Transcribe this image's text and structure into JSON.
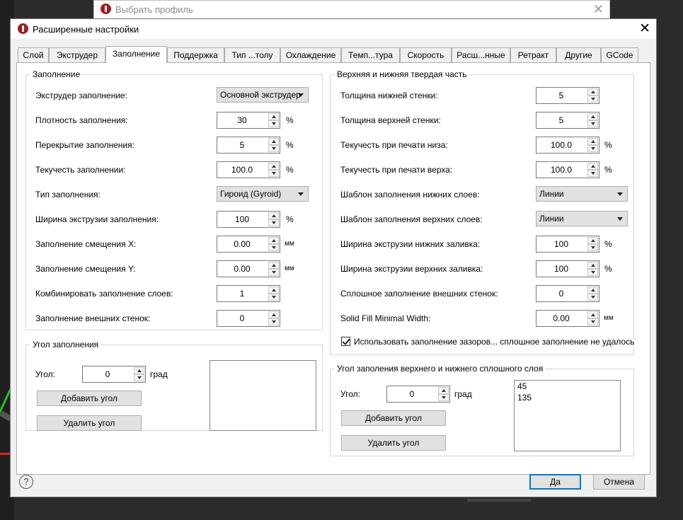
{
  "back_window": {
    "title": "Выбрать профиль",
    "close_glyph": "✕"
  },
  "dialog": {
    "title": "Расширенные настройки",
    "close_glyph": "✕"
  },
  "tabs": [
    {
      "label": "Слой"
    },
    {
      "label": "Экструдер"
    },
    {
      "label": "Заполнение"
    },
    {
      "label": "Поддержка"
    },
    {
      "label": "Тип ...толу"
    },
    {
      "label": "Охлаждение"
    },
    {
      "label": "Темп...тура"
    },
    {
      "label": "Скорость"
    },
    {
      "label": "Расш...нные"
    },
    {
      "label": "Ретракт"
    },
    {
      "label": "Другие"
    },
    {
      "label": "GCode"
    }
  ],
  "active_tab": "Заполнение",
  "infill": {
    "title": "Заполнение",
    "extruder_label": "Экструдер заполнение:",
    "extruder_value": "Основной экструдер",
    "density_label": "Плотность заполнения:",
    "density_value": "30",
    "density_unit": "%",
    "overlap_label": "Перекрытие заполнения:",
    "overlap_value": "5",
    "overlap_unit": "%",
    "flow_label": "Текучесть заполнении:",
    "flow_value": "100.0",
    "flow_unit": "%",
    "type_label": "Тип заполнения:",
    "type_value": "Гироид (Gyroid)",
    "width_label": "Ширина экструзии заполнения:",
    "width_value": "100",
    "width_unit": "%",
    "offset_x_label": "Заполнение смещения X:",
    "offset_x_value": "0.00",
    "offset_x_unit": "мм",
    "offset_y_label": "Заполнение смещения Y:",
    "offset_y_value": "0.00",
    "offset_y_unit": "мм",
    "combine_label": "Комбинировать заполнение слоев:",
    "combine_value": "1",
    "outer_label": "Заполнение внешних стенок:",
    "outer_value": "0"
  },
  "infill_angle": {
    "title": "Угол заполнения",
    "angle_label": "Угол:",
    "angle_value": "0",
    "angle_unit": "град",
    "add_label": "Добавить угол",
    "remove_label": "Удалить угол",
    "list": []
  },
  "solid": {
    "title": "Верхняя и нижняя твердая часть",
    "bottom_thickness_label": "Толщина нижней стенки:",
    "bottom_thickness_value": "5",
    "top_thickness_label": "Толщина верхней стенки:",
    "top_thickness_value": "5",
    "bottom_flow_label": "Текучесть при печати низа:",
    "bottom_flow_value": "100.0",
    "bottom_flow_unit": "%",
    "top_flow_label": "Текучесть при печати верха:",
    "top_flow_value": "100.0",
    "top_flow_unit": "%",
    "bottom_pattern_label": "Шаблон заполнения нижних слоев:",
    "bottom_pattern_value": "Линии",
    "top_pattern_label": "Шаблон заполнения верхних слоев:",
    "top_pattern_value": "Линии",
    "bottom_width_label": "Ширина экструзии нижних заливка:",
    "bottom_width_value": "100",
    "bottom_width_unit": "%",
    "top_width_label": "Ширина экструзии верхних заливка:",
    "top_width_value": "100",
    "top_width_unit": "%",
    "outer_solid_label": "Сплошное заполнение внешних стенок:",
    "outer_solid_value": "0",
    "min_width_label": "Solid Fill Minimal Width:",
    "min_width_value": "0.00",
    "min_width_unit": "мм",
    "gap_checkbox_label": "Использовать заполнение зазоров... сплошное заполнение не удалось",
    "gap_checkbox_checked": true
  },
  "solid_angle": {
    "title": "Угол заполения верхнего и нижнего сплошного слоя",
    "angle_label": "Угол:",
    "angle_value": "0",
    "angle_unit": "град",
    "add_label": "Добавить угол",
    "remove_label": "Удалить угол",
    "list": [
      "45",
      "135"
    ]
  },
  "footer": {
    "help_glyph": "?",
    "ok_label": "Да",
    "cancel_label": "Отмена"
  }
}
